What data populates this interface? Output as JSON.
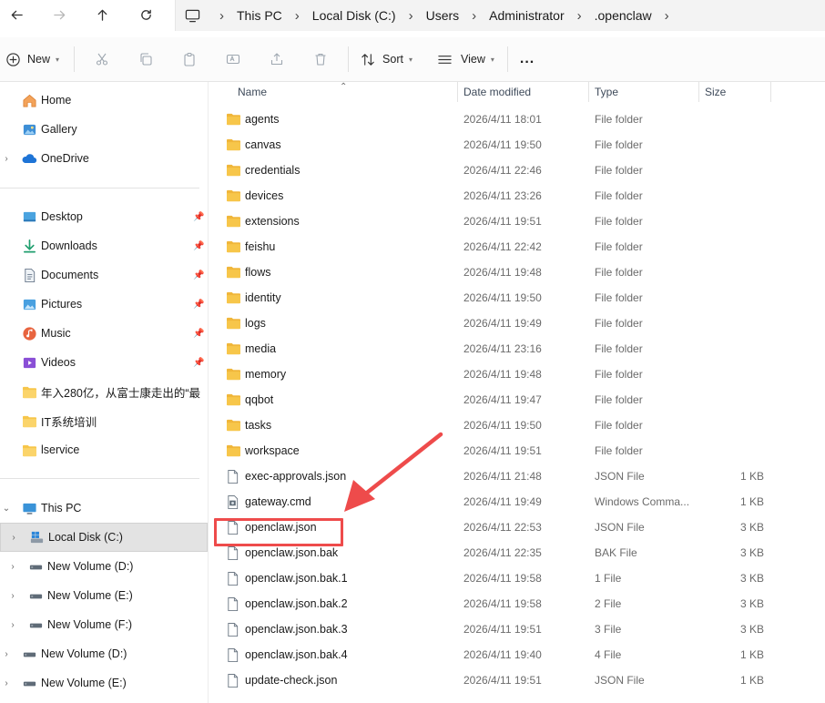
{
  "address": {
    "crumbs": [
      "This PC",
      "Local Disk (C:)",
      "Users",
      "Administrator",
      ".openclaw"
    ]
  },
  "toolbar": {
    "new_label": "New",
    "sort_label": "Sort",
    "view_label": "View",
    "more_label": "..."
  },
  "sidebar": {
    "home": "Home",
    "gallery": "Gallery",
    "onedrive": "OneDrive",
    "quick": [
      {
        "label": "Desktop",
        "icon": "desktop-icon"
      },
      {
        "label": "Downloads",
        "icon": "download-icon"
      },
      {
        "label": "Documents",
        "icon": "document-icon"
      },
      {
        "label": "Pictures",
        "icon": "pictures-icon"
      },
      {
        "label": "Music",
        "icon": "music-icon"
      },
      {
        "label": "Videos",
        "icon": "videos-icon"
      }
    ],
    "folders": [
      "年入280亿，从富士康走出的“最",
      "IT系统培训",
      "lservice"
    ],
    "this_pc": "This PC",
    "drives": [
      "Local Disk (C:)",
      "New Volume (D:)",
      "New Volume (E:)",
      "New Volume (F:)"
    ],
    "network_drives": [
      "New Volume (D:)",
      "New Volume (E:)"
    ]
  },
  "columns": {
    "name": "Name",
    "date": "Date modified",
    "type": "Type",
    "size": "Size"
  },
  "files": [
    {
      "name": "agents",
      "date": "2026/4/11 18:01",
      "type": "File folder",
      "size": "",
      "kind": "folder"
    },
    {
      "name": "canvas",
      "date": "2026/4/11 19:50",
      "type": "File folder",
      "size": "",
      "kind": "folder"
    },
    {
      "name": "credentials",
      "date": "2026/4/11 22:46",
      "type": "File folder",
      "size": "",
      "kind": "folder"
    },
    {
      "name": "devices",
      "date": "2026/4/11 23:26",
      "type": "File folder",
      "size": "",
      "kind": "folder"
    },
    {
      "name": "extensions",
      "date": "2026/4/11 19:51",
      "type": "File folder",
      "size": "",
      "kind": "folder"
    },
    {
      "name": "feishu",
      "date": "2026/4/11 22:42",
      "type": "File folder",
      "size": "",
      "kind": "folder"
    },
    {
      "name": "flows",
      "date": "2026/4/11 19:48",
      "type": "File folder",
      "size": "",
      "kind": "folder"
    },
    {
      "name": "identity",
      "date": "2026/4/11 19:50",
      "type": "File folder",
      "size": "",
      "kind": "folder"
    },
    {
      "name": "logs",
      "date": "2026/4/11 19:49",
      "type": "File folder",
      "size": "",
      "kind": "folder"
    },
    {
      "name": "media",
      "date": "2026/4/11 23:16",
      "type": "File folder",
      "size": "",
      "kind": "folder"
    },
    {
      "name": "memory",
      "date": "2026/4/11 19:48",
      "type": "File folder",
      "size": "",
      "kind": "folder"
    },
    {
      "name": "qqbot",
      "date": "2026/4/11 19:47",
      "type": "File folder",
      "size": "",
      "kind": "folder"
    },
    {
      "name": "tasks",
      "date": "2026/4/11 19:50",
      "type": "File folder",
      "size": "",
      "kind": "folder"
    },
    {
      "name": "workspace",
      "date": "2026/4/11 19:51",
      "type": "File folder",
      "size": "",
      "kind": "folder"
    },
    {
      "name": "exec-approvals.json",
      "date": "2026/4/11 21:48",
      "type": "JSON File",
      "size": "1 KB",
      "kind": "file"
    },
    {
      "name": "gateway.cmd",
      "date": "2026/4/11 19:49",
      "type": "Windows Comma...",
      "size": "1 KB",
      "kind": "cmd"
    },
    {
      "name": "openclaw.json",
      "date": "2026/4/11 22:53",
      "type": "JSON File",
      "size": "3 KB",
      "kind": "file"
    },
    {
      "name": "openclaw.json.bak",
      "date": "2026/4/11 22:35",
      "type": "BAK File",
      "size": "3 KB",
      "kind": "file"
    },
    {
      "name": "openclaw.json.bak.1",
      "date": "2026/4/11 19:58",
      "type": "1 File",
      "size": "3 KB",
      "kind": "file"
    },
    {
      "name": "openclaw.json.bak.2",
      "date": "2026/4/11 19:58",
      "type": "2 File",
      "size": "3 KB",
      "kind": "file"
    },
    {
      "name": "openclaw.json.bak.3",
      "date": "2026/4/11 19:51",
      "type": "3 File",
      "size": "3 KB",
      "kind": "file"
    },
    {
      "name": "openclaw.json.bak.4",
      "date": "2026/4/11 19:40",
      "type": "4 File",
      "size": "1 KB",
      "kind": "file"
    },
    {
      "name": "update-check.json",
      "date": "2026/4/11 19:51",
      "type": "JSON File",
      "size": "1 KB",
      "kind": "file"
    }
  ],
  "colors": {
    "folder": "#f7c64a",
    "annotation": "#ee4b4b",
    "selected": "#e3e3e3"
  }
}
